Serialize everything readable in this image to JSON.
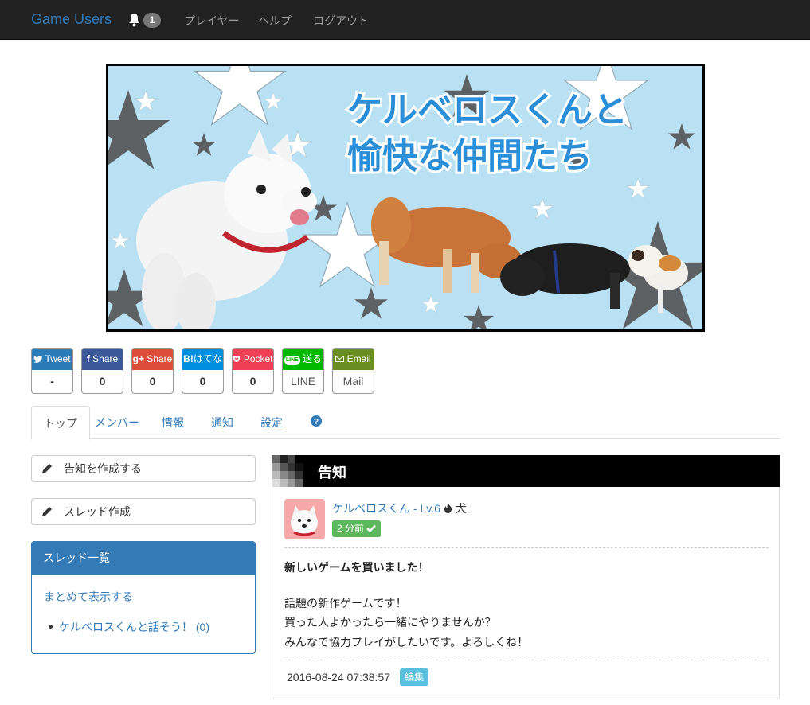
{
  "navbar": {
    "brand": "Game Users",
    "notification_count": "1",
    "links": [
      "プレイヤー",
      "ヘルプ",
      "ログアウト"
    ]
  },
  "banner": {
    "title_line1": "ケルベロスくんと",
    "title_line2": "愉快な仲間たち"
  },
  "share": [
    {
      "label": "Tweet",
      "count": "-",
      "color": "#2b7bb9",
      "icon": "twitter-icon"
    },
    {
      "label": "Share",
      "count": "0",
      "color": "#3b5998",
      "icon": "facebook-icon"
    },
    {
      "label": "Share",
      "count": "0",
      "color": "#dd4b39",
      "icon": "google-plus-icon"
    },
    {
      "label": "はてな",
      "count": "0",
      "color": "#008fde",
      "icon": "hatena-icon",
      "icon_text": "B!"
    },
    {
      "label": "Pocket",
      "count": "0",
      "color": "#ef4056",
      "icon": "pocket-icon"
    },
    {
      "label": "送る",
      "count": "LINE",
      "color": "#00b900",
      "icon": "line-icon",
      "icon_text": "LINE"
    },
    {
      "label": "Email",
      "count": "Mail",
      "color": "#6b8e23",
      "icon": "mail-icon"
    }
  ],
  "tabs": [
    "トップ",
    "メンバー",
    "情報",
    "通知",
    "設定"
  ],
  "left": {
    "create_notice": "告知を作成する",
    "create_thread": "スレッド作成",
    "thread_panel_title": "スレッド一覧",
    "show_all": "まとめて表示する",
    "thread_item": "ケルベロスくんと話そう！ (0)"
  },
  "notice": {
    "heading": "告知",
    "poster_name": "ケルベロスくん - Lv.6",
    "poster_kind": "犬",
    "posted_ago": "2 分前",
    "post_title": "新しいゲームを買いました！",
    "body_lines": [
      "話題の新作ゲームです！",
      "買った人よかったら一緒にやりませんか？",
      "みんなで協力プレイがしたいです。よろしくね！"
    ],
    "date": "2016-08-24 07:38:57",
    "edit_label": "編集"
  },
  "colors": {
    "navbar_bg": "#222222",
    "link": "#337ab7",
    "success": "#5cb85c",
    "info": "#5bc0de"
  }
}
